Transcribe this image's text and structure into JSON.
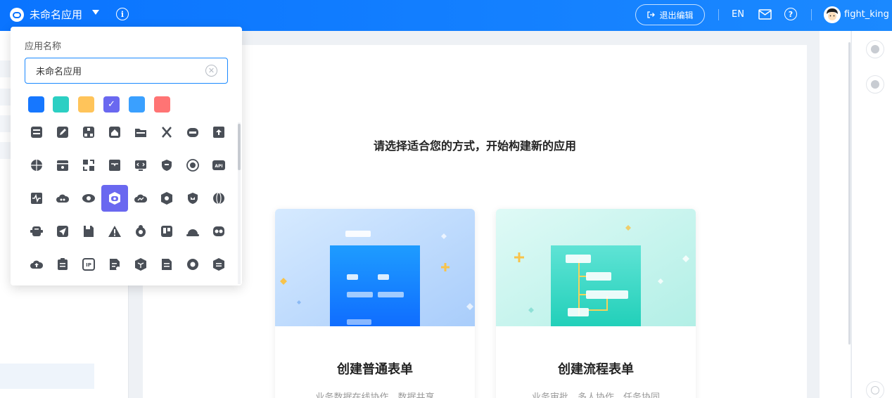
{
  "header": {
    "app_name": "未命名应用",
    "exit_edit": "退出编辑",
    "lang": "EN",
    "username": "fight_king"
  },
  "main": {
    "headline": "请选择适合您的方式，开始构建新的应用",
    "cards": [
      {
        "title": "创建普通表单",
        "desc": "业务数据在线协作，数据共享"
      },
      {
        "title": "创建流程表单",
        "desc": "业务审批，多人协作，任务协同"
      }
    ]
  },
  "popover": {
    "label": "应用名称",
    "input_value": "未命名应用",
    "colors": [
      "#1677ff",
      "#2ccfc3",
      "#ffc45a",
      "#6a68f0",
      "#3aa0ff",
      "#ff7474"
    ],
    "selected_color_index": 3,
    "selected_icon": "robot-face-icon",
    "icons": [
      [
        "document-lines-icon",
        "edit-icon",
        "sitemap-icon",
        "house-icon",
        "folder-icon",
        "utensils-icon",
        "robot-mask-icon",
        "upload-box-icon"
      ],
      [
        "globe-icon",
        "archive-box-icon",
        "scan-icon",
        "inbox-icon",
        "code-monitor-icon",
        "shield-icon",
        "orbit-icon",
        "api-icon"
      ],
      [
        "pulse-icon",
        "cloud-link-icon",
        "eye-icon",
        "robot-face-icon",
        "cloud-chart-icon",
        "hex-eye-icon",
        "shield-badge-icon",
        "planet-icon"
      ],
      [
        "server-icon",
        "send-icon",
        "save-icon",
        "warning-icon",
        "team-icon",
        "kanban-icon",
        "hat-icon",
        "mask-icon"
      ],
      [
        "cloud-upload-icon",
        "clipboard-icon",
        "ip-icon",
        "report-icon",
        "cube-icon",
        "list-icon",
        "lifebuoy-icon",
        "hex-list-icon"
      ]
    ]
  }
}
